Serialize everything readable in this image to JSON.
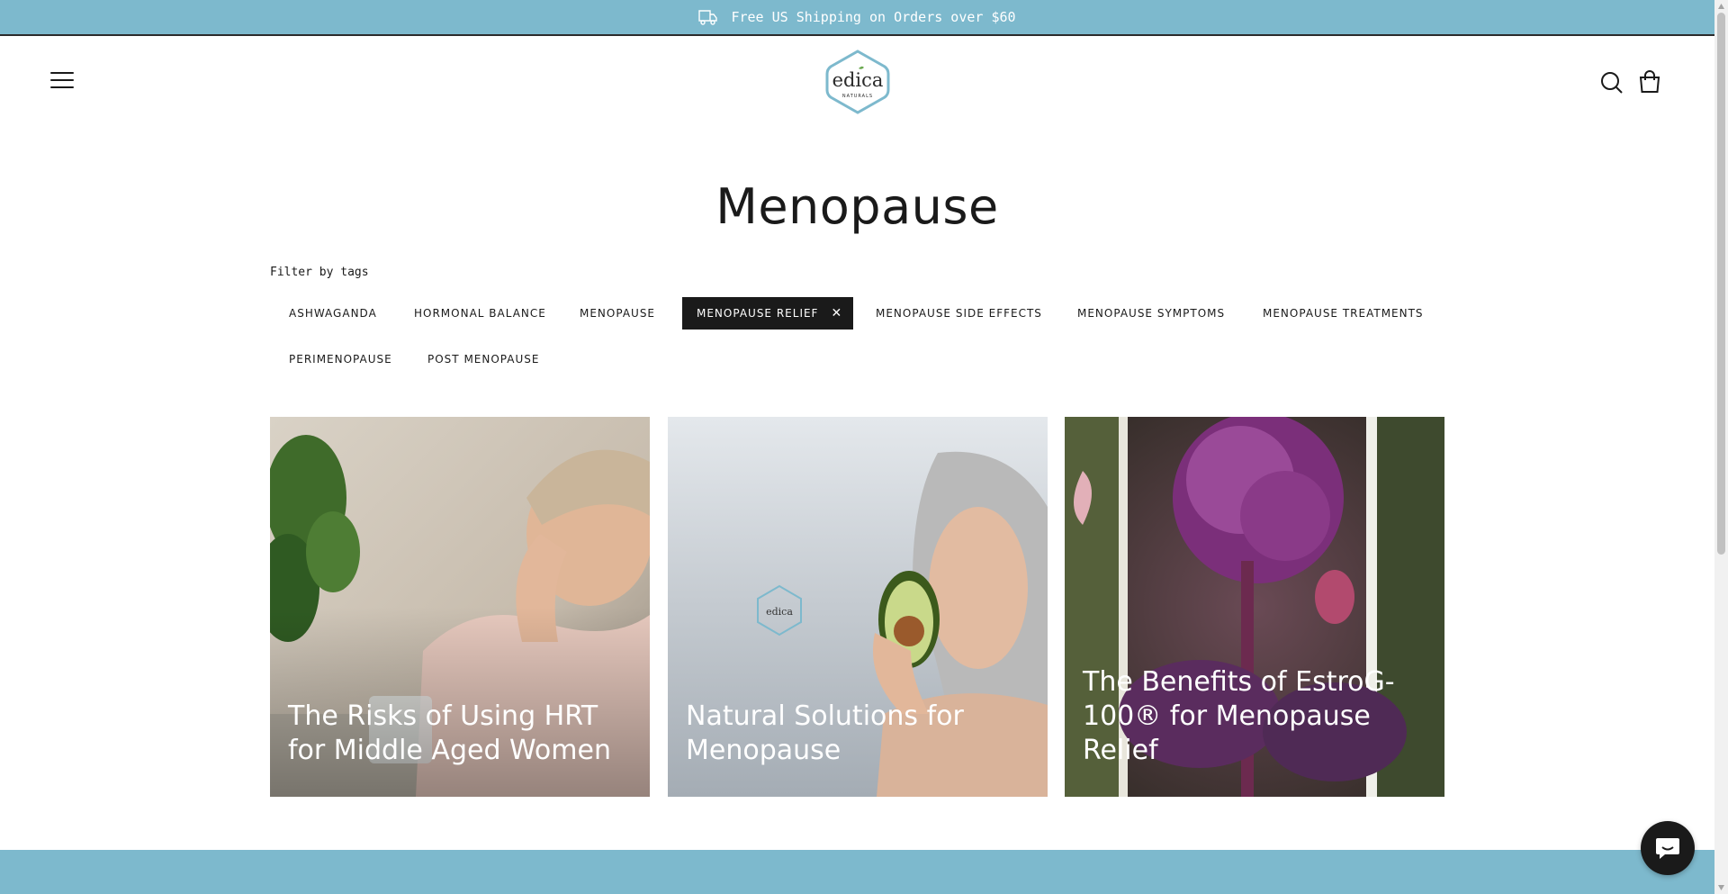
{
  "announcement": {
    "text": "Free US Shipping on Orders over $60",
    "icon": "delivery-truck-icon"
  },
  "header": {
    "menu_icon": "hamburger-menu-icon",
    "logo": {
      "brand": "edica",
      "tagline": "NATURALS"
    },
    "search_icon": "search-icon",
    "cart_icon": "shopping-bag-icon"
  },
  "page": {
    "title": "Menopause"
  },
  "filter": {
    "label": "Filter by tags",
    "tags": [
      {
        "label": "ASHWAGANDA",
        "active": false
      },
      {
        "label": "HORMONAL BALANCE",
        "active": false
      },
      {
        "label": "MENOPAUSE",
        "active": false
      },
      {
        "label": "MENOPAUSE RELIEF",
        "active": true,
        "remove_symbol": "✕"
      },
      {
        "label": "MENOPAUSE SIDE EFFECTS",
        "active": false
      },
      {
        "label": "MENOPAUSE SYMPTOMS",
        "active": false
      },
      {
        "label": "MENOPAUSE TREATMENTS",
        "active": false
      },
      {
        "label": "PERIMENOPAUSE",
        "active": false
      },
      {
        "label": "POST MENOPAUSE",
        "active": false
      }
    ]
  },
  "articles": [
    {
      "title": "The Risks of Using HRT for Middle Aged Women",
      "image": "woman-with-headache-photo"
    },
    {
      "title": "Natural Solutions for Menopause",
      "image": "woman-with-avocado-photo"
    },
    {
      "title": "The Benefits of EstroG-100® for Menopause Relief",
      "image": "purple-angelica-flower-photo"
    }
  ],
  "chat": {
    "icon": "chat-bubble-icon"
  },
  "colors": {
    "accent": "#7db9cd",
    "dark": "#1a1a1a",
    "white": "#ffffff"
  }
}
